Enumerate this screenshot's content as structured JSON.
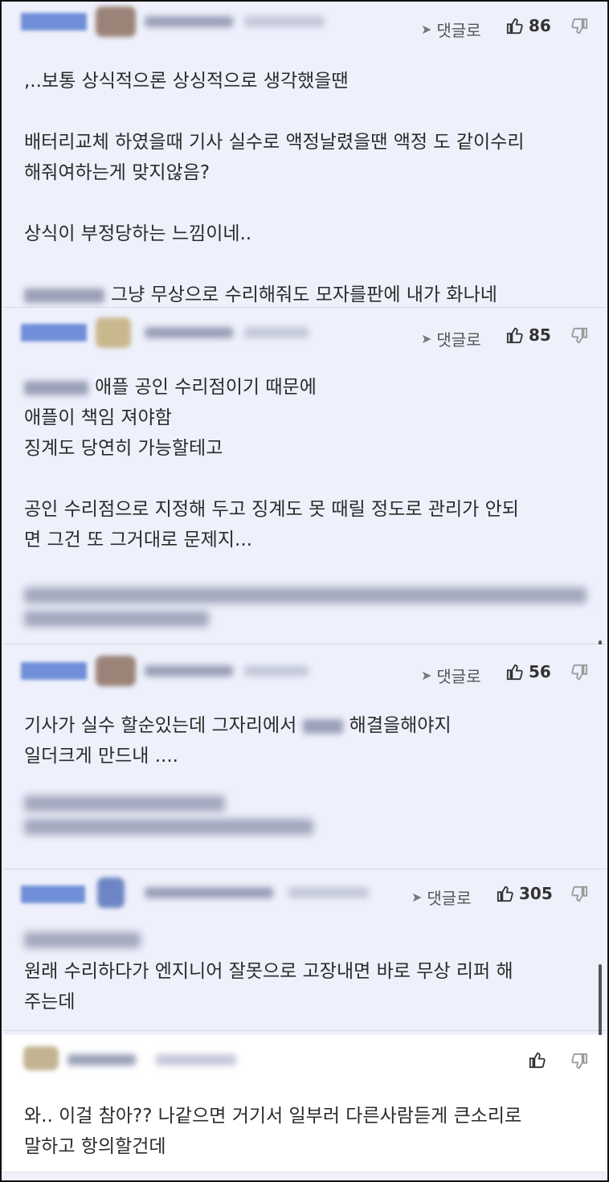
{
  "reply_label": "댓글로",
  "comments": [
    {
      "likes": "86",
      "lines": [
        ",..보통 상식적으론 상싱적으로 생각했을땐",
        "",
        "배터리교체 하였을때 기사 실수로 액정날렸을땐 액정 도 같이수리",
        "해줘여하는게 맞지않음?",
        "",
        "상식이 부정당하는 느낌이네..",
        "",
        "그냥 무상으로 수리해줘도 모자를판에 내가 화나네"
      ]
    },
    {
      "likes": "85",
      "lines": [
        "애플 공인 수리점이기 때문에",
        "애플이 책임 져야함",
        "징계도 당연히 가능할테고",
        "",
        "공인 수리점으로 지정해 두고 징계도 못 때릴 정도로 관리가 안되",
        "면 그건 또 그거대로 문제지..."
      ]
    },
    {
      "likes": "56",
      "lines": [
        "해결을해야지",
        "일더크게 만드내 ...."
      ],
      "line0_prefix": "기사가 실수 할순있는데 그자리에서"
    },
    {
      "likes": "305",
      "lines": [
        "원래 수리하다가 엔지니어 잘못으로 고장내면 바로 무상 리퍼 해",
        "주는데"
      ]
    },
    {
      "likes": "",
      "lines": [
        "와.. 이걸 참아?? 나같으면 거기서 일부러 다른사람듣게 큰소리로",
        "말하고 항의할건데"
      ]
    }
  ],
  "icons": {
    "reply": "send-arrow-icon",
    "like": "thumbs-up-icon",
    "dislike": "thumbs-down-icon"
  }
}
